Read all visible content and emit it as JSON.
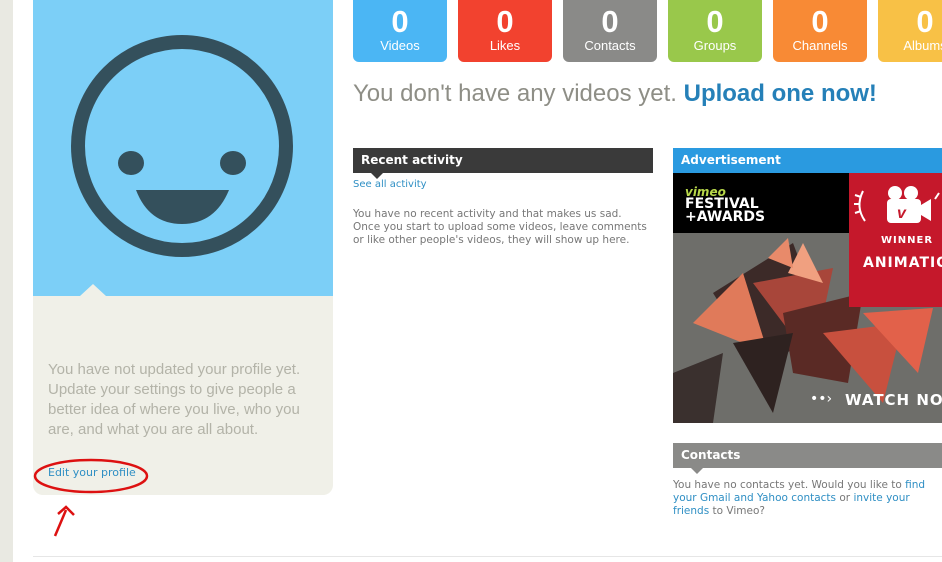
{
  "stats": [
    {
      "count": "0",
      "label": "Videos",
      "color": "#4bb6f4"
    },
    {
      "count": "0",
      "label": "Likes",
      "color": "#f2422f"
    },
    {
      "count": "0",
      "label": "Contacts",
      "color": "#8a8a88"
    },
    {
      "count": "0",
      "label": "Groups",
      "color": "#99c84b"
    },
    {
      "count": "0",
      "label": "Channels",
      "color": "#f88a35"
    },
    {
      "count": "0",
      "label": "Albums",
      "color": "#f8c146"
    }
  ],
  "headline": {
    "text": "You don't have any videos yet.",
    "link": "Upload one now!"
  },
  "profile": {
    "message": "You have not updated your profile yet. Update your settings to give people a better idea of where you live, who you are, and what you are all about.",
    "edit_link": "Edit your profile"
  },
  "recent_activity": {
    "title": "Recent activity",
    "see_all": "See all activity",
    "message": "You have no recent activity and that makes us sad. Once you start to upload some videos, leave comments or like other people's videos, they will show up here."
  },
  "advertisement": {
    "title": "Advertisement",
    "brand_line1": "vimeo",
    "brand_line2": "FESTIVAL +AWARDS",
    "winner": "WINNER",
    "category": "ANIMATION",
    "cta": "WATCH NOW"
  },
  "contacts": {
    "title": "Contacts",
    "text_1": "You have no contacts yet. Would you like to ",
    "link_1": "find your Gmail and Yahoo contacts",
    "text_2": " or ",
    "link_2": "invite your friends",
    "text_3": " to Vimeo?"
  },
  "colors": {
    "header_dark": "#3a3a3a",
    "header_blue": "#2a9ae0",
    "header_gray": "#8a8a88",
    "avatar_bg": "#7ccff7",
    "avatar_face": "#34505c",
    "annotation": "#dd1111"
  }
}
